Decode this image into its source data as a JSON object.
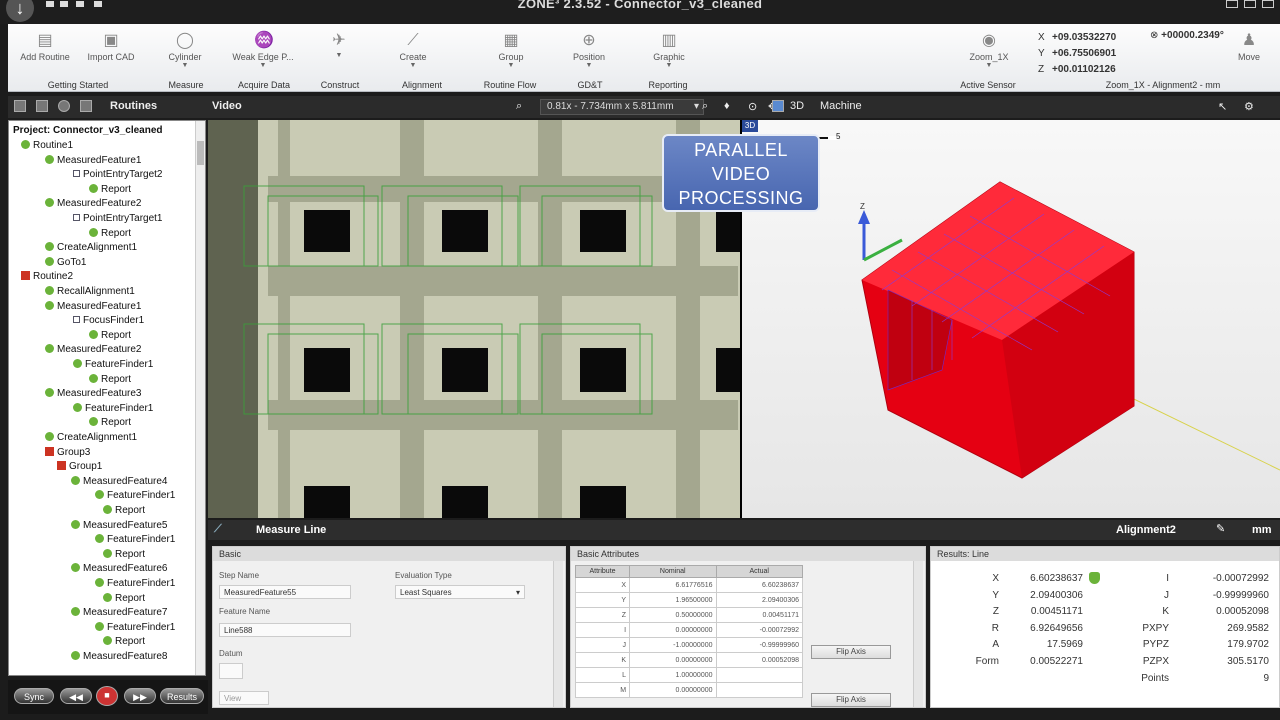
{
  "titlebar": {
    "title": "ZONE³ 2.3.52 - Connector_v3_cleaned"
  },
  "ribbon": {
    "tools": [
      {
        "label": "Add Routine",
        "icon": "add-routine-icon"
      },
      {
        "label": "Import CAD",
        "icon": "import-cad-icon"
      },
      {
        "label": "Cylinder",
        "icon": "cylinder-icon"
      },
      {
        "label": "Weak Edge P...",
        "icon": "weak-edge-icon"
      },
      {
        "label": "",
        "icon": "construct-icon"
      },
      {
        "label": "Create",
        "icon": "create-alignment-icon"
      },
      {
        "label": "Group",
        "icon": "group-icon"
      },
      {
        "label": "Position",
        "icon": "position-icon"
      },
      {
        "label": "Graphic",
        "icon": "graphic-icon"
      },
      {
        "label": "Zoom_1X",
        "icon": "zoom-sensor-icon"
      },
      {
        "label": "Move",
        "icon": "move-icon"
      }
    ],
    "groups": [
      "Getting Started",
      "Measure",
      "Acquire Data",
      "Construct",
      "Alignment",
      "Routine Flow",
      "GD&T",
      "Reporting",
      "Active Sensor",
      "Zoom_1X - Alignment2 - mm"
    ],
    "coords": {
      "x": "+09.03532270",
      "y": "+06.75506901",
      "z": "+00.01102126",
      "angle": "+00000.2349°"
    }
  },
  "subbar": {
    "routines": "Routines",
    "video": "Video",
    "zoom": "0.81x - 7.734mm x 5.811mm",
    "view": "3D",
    "machine": "Machine"
  },
  "tree": {
    "project": "Project: Connector_v3_cleaned",
    "items": [
      "Routine1",
      "MeasuredFeature1",
      "PointEntryTarget2",
      "Report",
      "MeasuredFeature2",
      "PointEntryTarget1",
      "Report",
      "CreateAlignment1",
      "GoTo1",
      "Routine2",
      "RecallAlignment1",
      "MeasuredFeature1",
      "FocusFinder1",
      "Report",
      "MeasuredFeature2",
      "FeatureFinder1",
      "Report",
      "MeasuredFeature3",
      "FeatureFinder1",
      "Report",
      "CreateAlignment1",
      "Group3",
      "Group1",
      "MeasuredFeature4",
      "FeatureFinder1",
      "Report",
      "MeasuredFeature5",
      "FeatureFinder1",
      "Report",
      "MeasuredFeature6",
      "FeatureFinder1",
      "Report",
      "MeasuredFeature7",
      "FeatureFinder1",
      "Report",
      "MeasuredFeature8"
    ]
  },
  "bottom_buttons": {
    "sync": "Sync",
    "results": "Results"
  },
  "overlay": {
    "line1": "PARALLEL",
    "line2": "VIDEO",
    "line3": "PROCESSING"
  },
  "cad": {
    "badge": "3D",
    "z_axis": "Z",
    "tick": "5"
  },
  "measure": {
    "title": "Measure Line",
    "alignment": "Alignment2",
    "unit": "mm"
  },
  "basic": {
    "header": "Basic",
    "step_name_label": "Step Name",
    "step_name": "MeasuredFeature55",
    "feature_name_label": "Feature Name",
    "feature_name": "Line588",
    "datum_label": "Datum",
    "eval_label": "Evaluation Type",
    "eval_value": "Least Squares",
    "view_btn": "View"
  },
  "attributes": {
    "header": "Basic Attributes",
    "cols": [
      "Attribute",
      "Nominal",
      "Actual"
    ],
    "rows": [
      [
        "X",
        "6.61776516",
        "6.60238637"
      ],
      [
        "Y",
        "1.96500000",
        "2.09400306"
      ],
      [
        "Z",
        "0.50000000",
        "0.00451171"
      ],
      [
        "I",
        "0.00000000",
        "-0.00072992"
      ],
      [
        "J",
        "-1.00000000",
        "-0.99999960"
      ],
      [
        "K",
        "0.00000000",
        "0.00052098"
      ],
      [
        "L",
        "1.00000000",
        ""
      ],
      [
        "M",
        "0.00000000",
        ""
      ]
    ],
    "flip1": "Flip Axis",
    "flip2": "Flip Axis"
  },
  "results": {
    "header": "Results: Line",
    "left": [
      [
        "X",
        "6.60238637"
      ],
      [
        "Y",
        "2.09400306"
      ],
      [
        "Z",
        "0.00451171"
      ],
      [
        "R",
        "6.92649656"
      ],
      [
        "A",
        "17.5969"
      ],
      [
        "Form",
        "0.00522271"
      ]
    ],
    "right": [
      [
        "I",
        "-0.00072992"
      ],
      [
        "J",
        "-0.99999960"
      ],
      [
        "K",
        "0.00052098"
      ],
      [
        "PXPY",
        "269.9582"
      ],
      [
        "PYPZ",
        "179.9702"
      ],
      [
        "PZPX",
        "305.5170"
      ],
      [
        "Points",
        "9"
      ]
    ],
    "status_color": "#6bb33a"
  }
}
